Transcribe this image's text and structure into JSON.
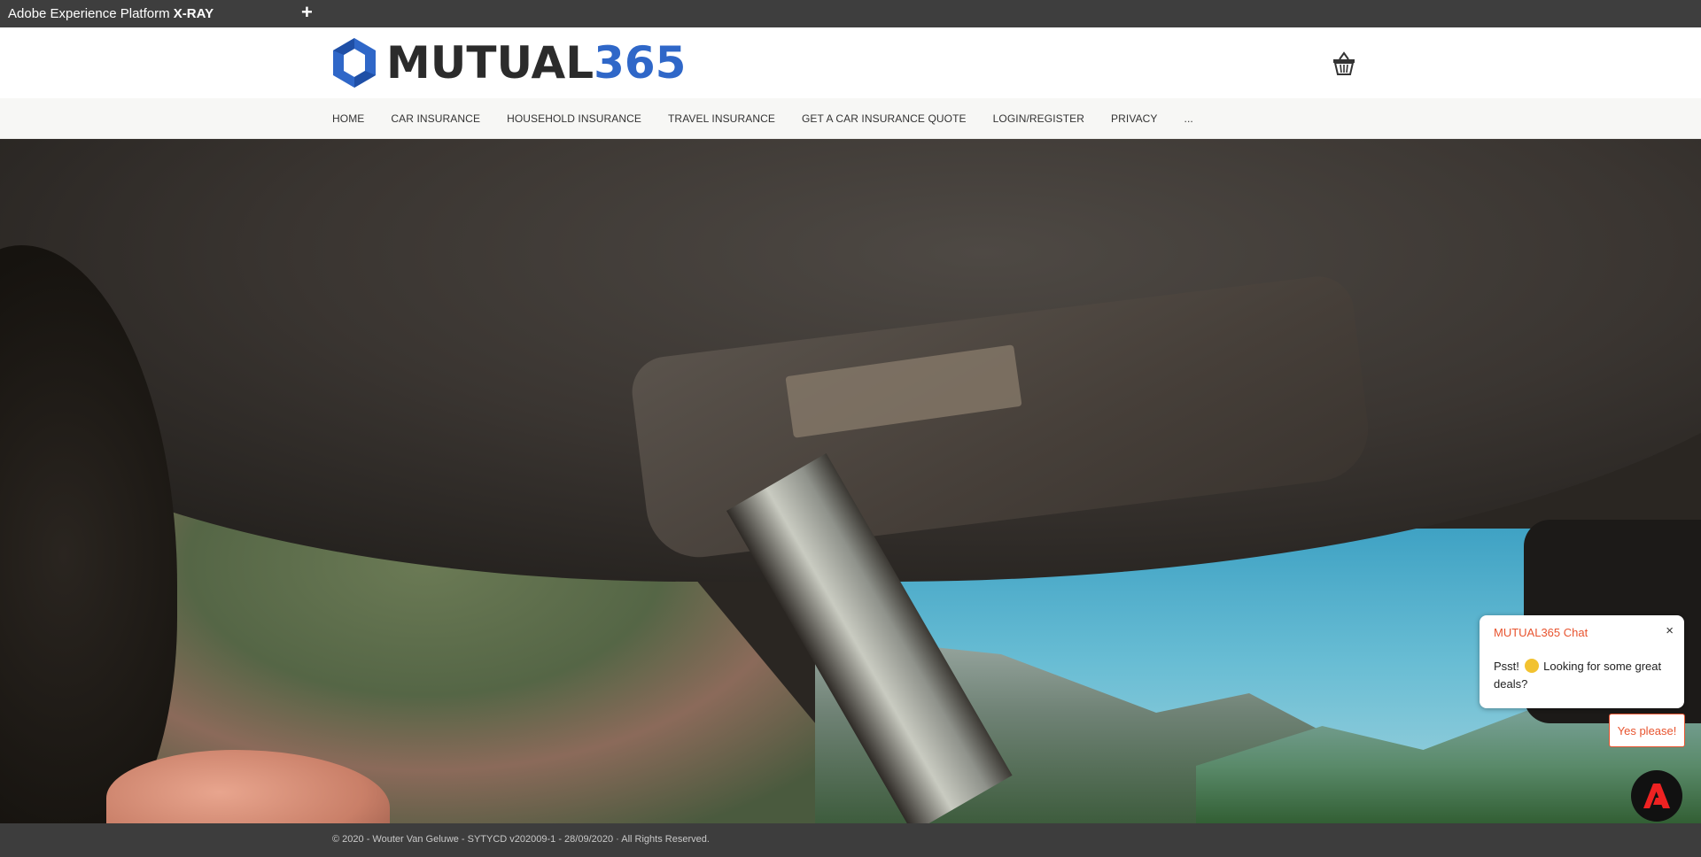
{
  "toolbar": {
    "title_prefix": "Adobe Experience Platform ",
    "title_bold": "X-RAY",
    "add_label": "+"
  },
  "brand": {
    "name_part1": "MUTUAL",
    "name_part2": "365",
    "colors": {
      "blue": "#2f67c8",
      "dark": "#2b2b2b"
    }
  },
  "nav": {
    "items": [
      "HOME",
      "CAR INSURANCE",
      "HOUSEHOLD INSURANCE",
      "TRAVEL INSURANCE",
      "GET A CAR INSURANCE QUOTE",
      "LOGIN/REGISTER",
      "PRIVACY",
      "..."
    ]
  },
  "icons": {
    "cart": "basket-icon",
    "close": "close-icon",
    "launcher": "adobe-icon"
  },
  "chat": {
    "title": "MUTUAL365 Chat",
    "close_label": "×",
    "message_before": "Psst!",
    "message_after": "Looking for some great deals?",
    "cta_label": "Yes please!",
    "accent": "#e8542f"
  },
  "footer": {
    "text": "© 2020 - Wouter Van Geluwe - SYTYCD v202009-1 - 28/09/2020 · All Rights Reserved."
  }
}
